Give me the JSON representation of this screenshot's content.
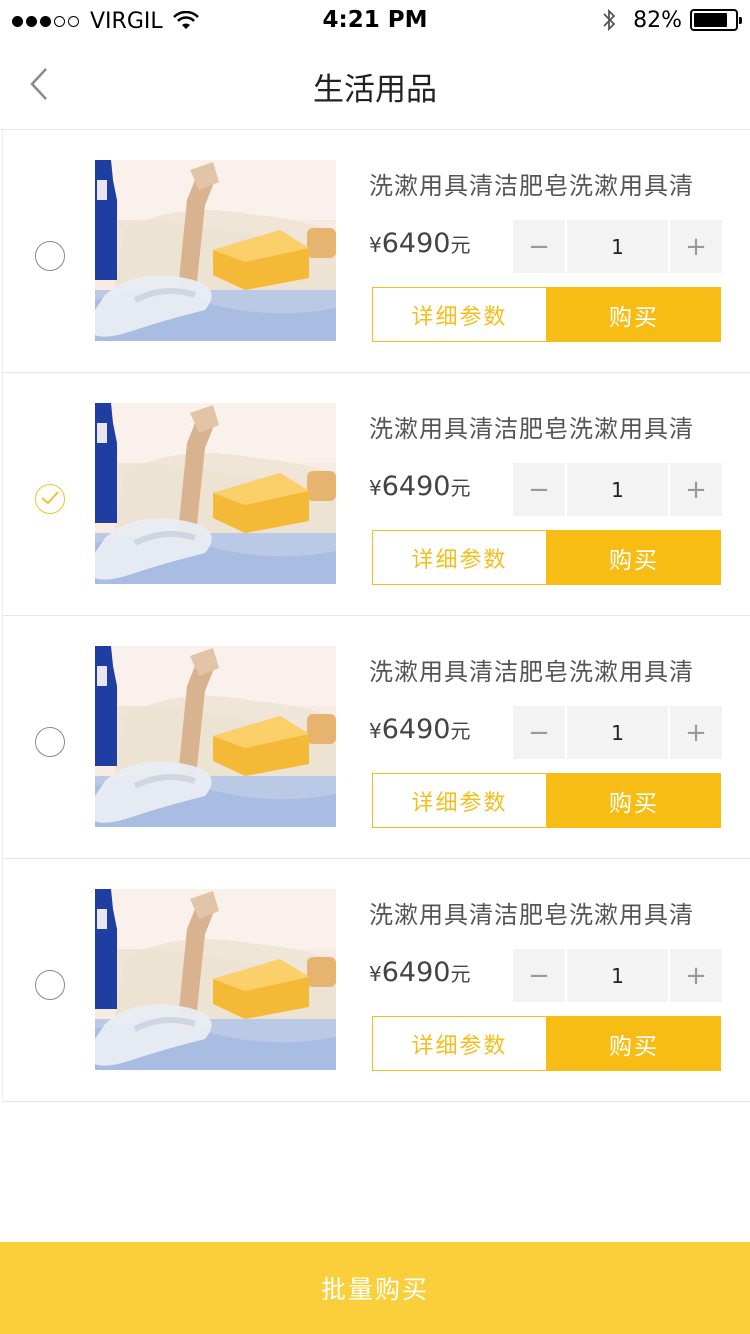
{
  "status_bar": {
    "carrier": "VIRGIL",
    "time": "4:21 PM",
    "battery_percent": "82%",
    "battery_level": 0.82
  },
  "nav": {
    "title": "生活用品"
  },
  "products": [
    {
      "title": "洗漱用具清洁肥皂洗漱用具清",
      "currency": "¥",
      "price": "6490",
      "unit": "元",
      "quantity": "1",
      "detail_label": "详细参数",
      "buy_label": "购买",
      "selected": false
    },
    {
      "title": "洗漱用具清洁肥皂洗漱用具清",
      "currency": "¥",
      "price": "6490",
      "unit": "元",
      "quantity": "1",
      "detail_label": "详细参数",
      "buy_label": "购买",
      "selected": true
    },
    {
      "title": "洗漱用具清洁肥皂洗漱用具清",
      "currency": "¥",
      "price": "6490",
      "unit": "元",
      "quantity": "1",
      "detail_label": "详细参数",
      "buy_label": "购买",
      "selected": false
    },
    {
      "title": "洗漱用具清洁肥皂洗漱用具清",
      "currency": "¥",
      "price": "6490",
      "unit": "元",
      "quantity": "1",
      "detail_label": "详细参数",
      "buy_label": "购买",
      "selected": false
    }
  ],
  "stepper": {
    "minus": "−",
    "plus": "+"
  },
  "bottom": {
    "bulk_buy_label": "批量购买"
  },
  "colors": {
    "accent": "#f8bd15",
    "bottom_bar": "#fbcf3a"
  }
}
